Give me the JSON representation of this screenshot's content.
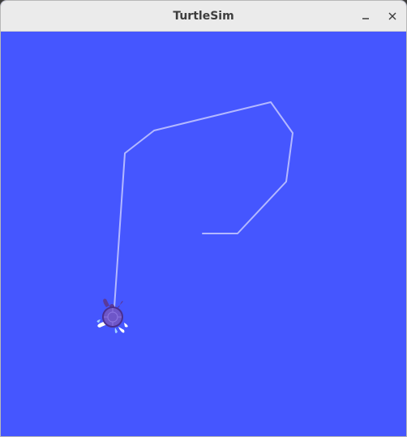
{
  "window": {
    "title": "TurtleSim",
    "minimize_icon": "minimize-icon",
    "close_icon": "close-icon"
  },
  "canvas": {
    "background_color": "#4556ff",
    "pen_color": "#b3b8ff",
    "turtle_color": "#6e56c8"
  }
}
